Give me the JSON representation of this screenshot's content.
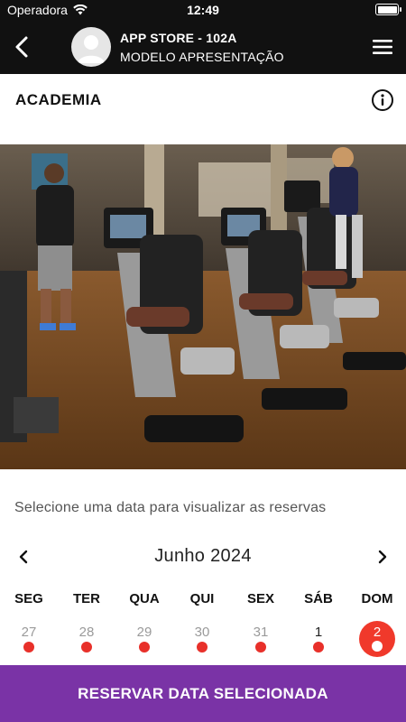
{
  "status_bar": {
    "carrier": "Operadora",
    "time": "12:49"
  },
  "header": {
    "title": "APP STORE - 102A",
    "subtitle": "MODELO APRESENTAÇÃO"
  },
  "section": {
    "title": "ACADEMIA"
  },
  "hero_image": {
    "subject": "gym-equipment-photo"
  },
  "calendar": {
    "instruction": "Selecione uma data para visualizar as reservas",
    "month": "Junho 2024",
    "weekdays": [
      "SEG",
      "TER",
      "QUA",
      "QUI",
      "SEX",
      "SÁB",
      "DOM"
    ],
    "days": [
      {
        "label": "27",
        "state": "muted",
        "has_event": true
      },
      {
        "label": "28",
        "state": "muted",
        "has_event": true
      },
      {
        "label": "29",
        "state": "muted",
        "has_event": true
      },
      {
        "label": "30",
        "state": "muted",
        "has_event": true
      },
      {
        "label": "31",
        "state": "muted",
        "has_event": true
      },
      {
        "label": "1",
        "state": "current",
        "has_event": true
      },
      {
        "label": "2",
        "state": "selected",
        "has_event": true
      }
    ]
  },
  "action": {
    "reserve_label": "RESERVAR DATA SELECIONADA"
  },
  "colors": {
    "header_bg": "#111111",
    "accent_red": "#e8302a",
    "button_purple": "#7a33a6"
  }
}
